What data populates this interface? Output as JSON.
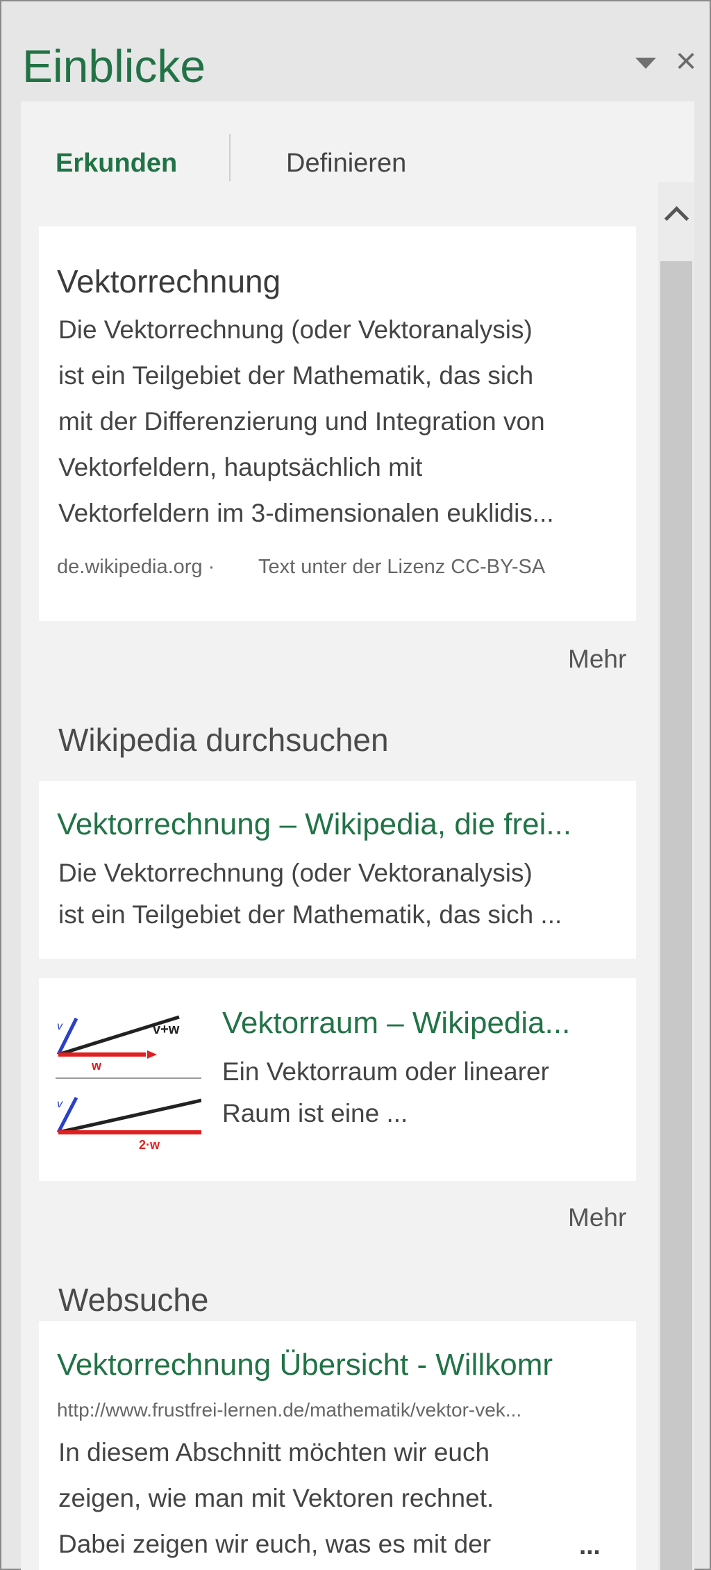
{
  "pane": {
    "title": "Einblicke"
  },
  "tabs": [
    {
      "label": "Erkunden",
      "active": true
    },
    {
      "label": "Definieren",
      "active": false
    }
  ],
  "definition_card": {
    "title": "Vektorrechnung",
    "lines": [
      "Die Vektorrechnung (oder Vektoranalysis)",
      "ist ein Teilgebiet der Mathematik, das sich",
      "mit der Differenzierung und Integration von",
      "Vektorfeldern, hauptsächlich mit",
      "Vektorfeldern im 3-dimensionalen euklidis..."
    ],
    "source": "de.wikipedia.org ·",
    "license": "Text unter der Lizenz CC-BY-SA"
  },
  "more_label_1": "Mehr",
  "wikipedia_section": {
    "heading": "Wikipedia durchsuchen",
    "results": [
      {
        "title": "Vektorrechnung – Wikipedia, die frei...",
        "lines": [
          "Die Vektorrechnung (oder Vektoranalysis)",
          "ist ein Teilgebiet der Mathematik, das sich ..."
        ]
      },
      {
        "title": "Vektorraum – Wikipedia...",
        "lines": [
          "Ein Vektorraum oder linearer",
          "Raum ist eine ..."
        ],
        "thumbnail_labels": [
          "v+w",
          "w",
          "v",
          "v",
          "2·w"
        ]
      }
    ]
  },
  "more_label_2": "Mehr",
  "web_section": {
    "heading": "Websuche",
    "result": {
      "title": "Vektorrechnung Übersicht - Willkomr",
      "url": "http://www.frustfrei-lernen.de/mathematik/vektor-vek...",
      "lines": [
        "In diesem Abschnitt möchten wir euch",
        "zeigen, wie man mit Vektoren rechnet.",
        "Dabei zeigen wir euch, was es mit der"
      ],
      "ellipsis": "..."
    }
  },
  "colors": {
    "accent": "#217346",
    "pane_background": "#e6e6e6",
    "card_background": "#ffffff",
    "thumbnail_red": "#e02020",
    "thumbnail_blue": "#2a40c8"
  },
  "icons": {
    "pane_menu": "triangle-down-icon",
    "pane_close": "close-icon",
    "scroll_up": "chevron-up-icon"
  }
}
